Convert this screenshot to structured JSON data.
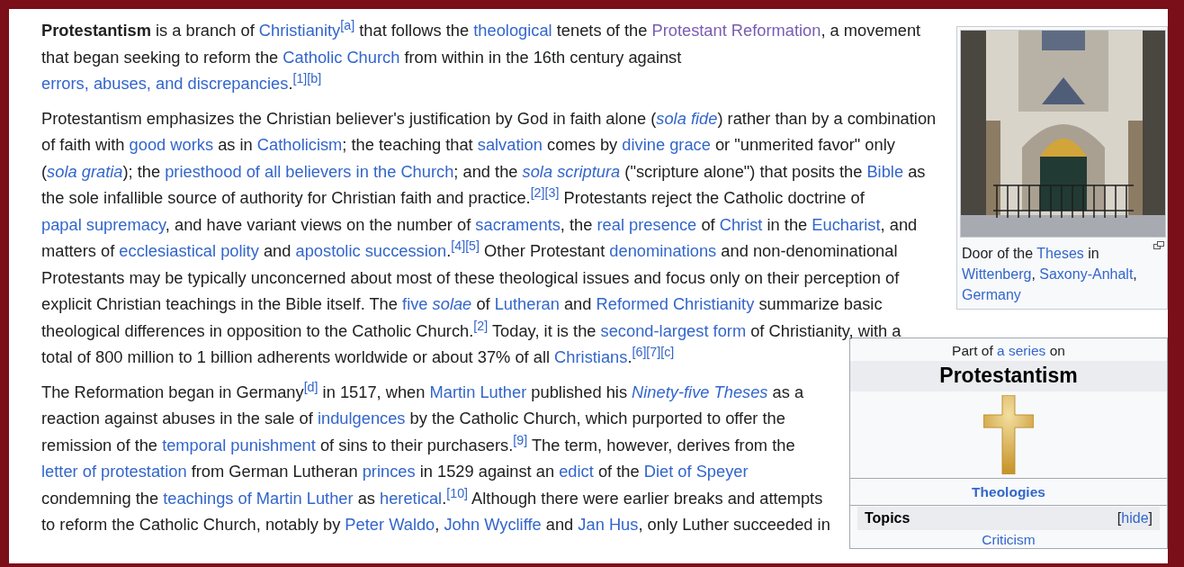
{
  "paragraphs": [
    [
      {
        "kind": "bold",
        "text": "Protestantism"
      },
      {
        "kind": "text",
        "text": " is a branch of "
      },
      {
        "kind": "link",
        "text": "Christianity"
      },
      {
        "kind": "ref",
        "text": "[a]"
      },
      {
        "kind": "text",
        "text": " that follows the "
      },
      {
        "kind": "link",
        "text": "theological"
      },
      {
        "kind": "text",
        "text": " tenets of the "
      },
      {
        "kind": "visited",
        "text": "Protestant Reformation"
      },
      {
        "kind": "text",
        "text": ", a movement that began seeking to reform the "
      },
      {
        "kind": "link",
        "text": "Catholic Church"
      },
      {
        "kind": "text",
        "text": " from within in the 16th century against "
      },
      {
        "kind": "link",
        "text": "errors, abuses, and discrepancies"
      },
      {
        "kind": "text",
        "text": "."
      },
      {
        "kind": "ref",
        "text": "[1]"
      },
      {
        "kind": "ref",
        "text": "[b]"
      }
    ],
    [
      {
        "kind": "text",
        "text": "Protestantism emphasizes the Christian believer's justification by God in faith alone ("
      },
      {
        "kind": "link",
        "text": "*sola fide*"
      },
      {
        "kind": "text",
        "text": ") rather than by a combination of faith with "
      },
      {
        "kind": "link",
        "text": "good works"
      },
      {
        "kind": "text",
        "text": " as in "
      },
      {
        "kind": "link",
        "text": "Catholicism"
      },
      {
        "kind": "text",
        "text": "; the teaching that "
      },
      {
        "kind": "link",
        "text": "salvation"
      },
      {
        "kind": "text",
        "text": " comes by "
      },
      {
        "kind": "link",
        "text": "divine grace"
      },
      {
        "kind": "text",
        "text": " or \"unmerited favor\" only ("
      },
      {
        "kind": "link",
        "text": "*sola gratia*"
      },
      {
        "kind": "text",
        "text": "); the "
      },
      {
        "kind": "link",
        "text": "priesthood of all believers in the Church"
      },
      {
        "kind": "text",
        "text": "; and the "
      },
      {
        "kind": "link",
        "text": "*sola scriptura*"
      },
      {
        "kind": "text",
        "text": " (\"scripture alone\") that posits the "
      },
      {
        "kind": "link",
        "text": "Bible"
      },
      {
        "kind": "text",
        "text": " as the sole infallible source of authority for Christian faith and practice."
      },
      {
        "kind": "ref",
        "text": "[2]"
      },
      {
        "kind": "ref",
        "text": "[3]"
      },
      {
        "kind": "text",
        "text": " Protestants reject the Catholic doctrine of "
      },
      {
        "kind": "link",
        "text": "papal supremacy"
      },
      {
        "kind": "text",
        "text": ", and have variant views on the number of "
      },
      {
        "kind": "link",
        "text": "sacraments"
      },
      {
        "kind": "text",
        "text": ", the "
      },
      {
        "kind": "link",
        "text": "real presence"
      },
      {
        "kind": "text",
        "text": " of "
      },
      {
        "kind": "link",
        "text": "Christ"
      },
      {
        "kind": "text",
        "text": " in the "
      },
      {
        "kind": "link",
        "text": "Eucharist"
      },
      {
        "kind": "text",
        "text": ", and matters of "
      },
      {
        "kind": "link",
        "text": "ecclesiastical polity"
      },
      {
        "kind": "text",
        "text": " and "
      },
      {
        "kind": "link",
        "text": "apostolic succession"
      },
      {
        "kind": "text",
        "text": "."
      },
      {
        "kind": "ref",
        "text": "[4]"
      },
      {
        "kind": "ref",
        "text": "[5]"
      },
      {
        "kind": "text",
        "text": " Other Protestant "
      },
      {
        "kind": "link",
        "text": "denominations"
      },
      {
        "kind": "text",
        "text": " and non-denominational Protestants may be typically unconcerned about most of these theological issues and focus only on their perception of explicit Christian teachings in the Bible itself. The "
      },
      {
        "kind": "link",
        "text": "five *solae*"
      },
      {
        "kind": "text",
        "text": " of "
      },
      {
        "kind": "link",
        "text": "Lutheran"
      },
      {
        "kind": "text",
        "text": " and "
      },
      {
        "kind": "link",
        "text": "Reformed Christianity"
      },
      {
        "kind": "text",
        "text": " summarize basic theological differences in opposition to the Catholic Church."
      },
      {
        "kind": "ref",
        "text": "[2]"
      },
      {
        "kind": "break"
      },
      {
        "kind": "text",
        "text": " Today, it is the "
      },
      {
        "kind": "link",
        "text": "second-largest form"
      },
      {
        "kind": "text",
        "text": " of Christianity, with a total of 800 million to 1 billion adherents worldwide or about 37% of all "
      },
      {
        "kind": "link",
        "text": "Christians"
      },
      {
        "kind": "text",
        "text": "."
      },
      {
        "kind": "ref",
        "text": "[6]"
      },
      {
        "kind": "ref",
        "text": "[7]"
      },
      {
        "kind": "ref",
        "text": "[c]"
      }
    ],
    [
      {
        "kind": "text",
        "text": "The Reformation began in Germany"
      },
      {
        "kind": "ref",
        "text": "[d]"
      },
      {
        "kind": "text",
        "text": " in 1517, when "
      },
      {
        "kind": "link",
        "text": "Martin Luther"
      },
      {
        "kind": "text",
        "text": " published his "
      },
      {
        "kind": "link",
        "text": "*Ninety-five Theses*"
      },
      {
        "kind": "text",
        "text": " as a reaction against abuses in the sale of "
      },
      {
        "kind": "link",
        "text": "indulgences"
      },
      {
        "kind": "text",
        "text": " by the Catholic Church, which purported to offer the remission of the "
      },
      {
        "kind": "link",
        "text": "temporal punishment"
      },
      {
        "kind": "text",
        "text": " of sins to their purchasers."
      },
      {
        "kind": "ref",
        "text": "[9]"
      },
      {
        "kind": "text",
        "text": " The term, however, derives from the "
      },
      {
        "kind": "link",
        "text": "letter of protestation"
      },
      {
        "kind": "text",
        "text": " from German Lutheran "
      },
      {
        "kind": "link",
        "text": "princes"
      },
      {
        "kind": "text",
        "text": " in 1529 against an "
      },
      {
        "kind": "link",
        "text": "edict"
      },
      {
        "kind": "text",
        "text": " of the "
      },
      {
        "kind": "link",
        "text": "Diet of Speyer"
      },
      {
        "kind": "text",
        "text": " condemning the "
      },
      {
        "kind": "link",
        "text": "teachings of Martin Luther"
      },
      {
        "kind": "text",
        "text": " as "
      },
      {
        "kind": "link",
        "text": "heretical"
      },
      {
        "kind": "text",
        "text": "."
      },
      {
        "kind": "ref",
        "text": "[10]"
      },
      {
        "kind": "text",
        "text": " Although there were earlier breaks and attempts to reform the Catholic Church, notably by "
      },
      {
        "kind": "link",
        "text": "Peter Waldo"
      },
      {
        "kind": "text",
        "text": ", "
      },
      {
        "kind": "link",
        "text": "John Wycliffe"
      },
      {
        "kind": "text",
        "text": " and "
      },
      {
        "kind": "link",
        "text": "Jan Hus"
      },
      {
        "kind": "text",
        "text": ", only Luther succeeded in"
      }
    ]
  ],
  "thumbnail": {
    "kind": "picture",
    "caption": [
      {
        "kind": "text",
        "text": "Door of the "
      },
      {
        "kind": "link",
        "text": "Theses"
      },
      {
        "kind": "text",
        "text": " in "
      },
      {
        "kind": "link",
        "text": "Wittenberg"
      },
      {
        "kind": "text",
        "text": ", "
      },
      {
        "kind": "link",
        "text": "Saxony-Anhalt"
      },
      {
        "kind": "text",
        "text": ", "
      },
      {
        "kind": "link",
        "text": "Germany"
      }
    ]
  },
  "infobox": {
    "above": [
      {
        "kind": "text",
        "text": "Part of "
      },
      {
        "kind": "link",
        "text": "a series"
      },
      {
        "kind": "text",
        "text": " on"
      }
    ],
    "title": "Protestantism",
    "heading_link": "Theologies",
    "section": {
      "title": "Topics",
      "toggle_open": "[",
      "toggle_link": "hide",
      "toggle_close": "]",
      "items": [
        "Criticism"
      ]
    }
  }
}
